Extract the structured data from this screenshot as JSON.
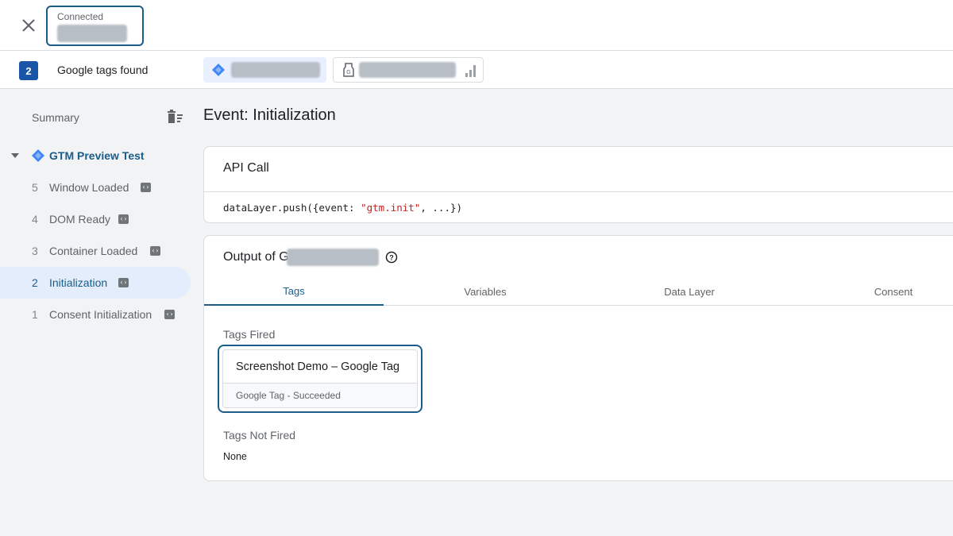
{
  "connection": {
    "status_label": "Connected"
  },
  "tags_bar": {
    "count": "2",
    "label": "Google tags found"
  },
  "sidebar": {
    "summary_label": "Summary",
    "container_name": "GTM Preview Test",
    "events": [
      {
        "num": "5",
        "label": "Window Loaded",
        "active": false
      },
      {
        "num": "4",
        "label": "DOM Ready",
        "active": false
      },
      {
        "num": "3",
        "label": "Container Loaded",
        "active": false
      },
      {
        "num": "2",
        "label": "Initialization",
        "active": true
      },
      {
        "num": "1",
        "label": "Consent Initialization",
        "active": false
      }
    ]
  },
  "main": {
    "event_title": "Event: Initialization",
    "api_call_header": "API Call",
    "api_code_prefix": "dataLayer.push({event: ",
    "api_code_string": "\"gtm.init\"",
    "api_code_suffix": ", ...})",
    "output_header": "Output of G",
    "tabs": [
      {
        "label": "Tags",
        "active": true
      },
      {
        "label": "Variables",
        "active": false
      },
      {
        "label": "Data Layer",
        "active": false
      },
      {
        "label": "Consent",
        "active": false
      }
    ],
    "tags_fired_label": "Tags Fired",
    "fired_tag": {
      "name": "Screenshot Demo – Google Tag",
      "status": "Google Tag - Succeeded"
    },
    "tags_not_fired_label": "Tags Not Fired",
    "tags_not_fired_value": "None"
  },
  "colors": {
    "accent": "#1a5d8a",
    "badge": "#1a56a8",
    "active_bg": "#e3edfb",
    "code_string": "#c5221f"
  },
  "icons": [
    "close-icon",
    "gtm-diamond-icon",
    "google-tag-icon",
    "bar-chart-icon",
    "delete-list-icon",
    "caret-down-icon",
    "code-icon",
    "help-icon"
  ]
}
